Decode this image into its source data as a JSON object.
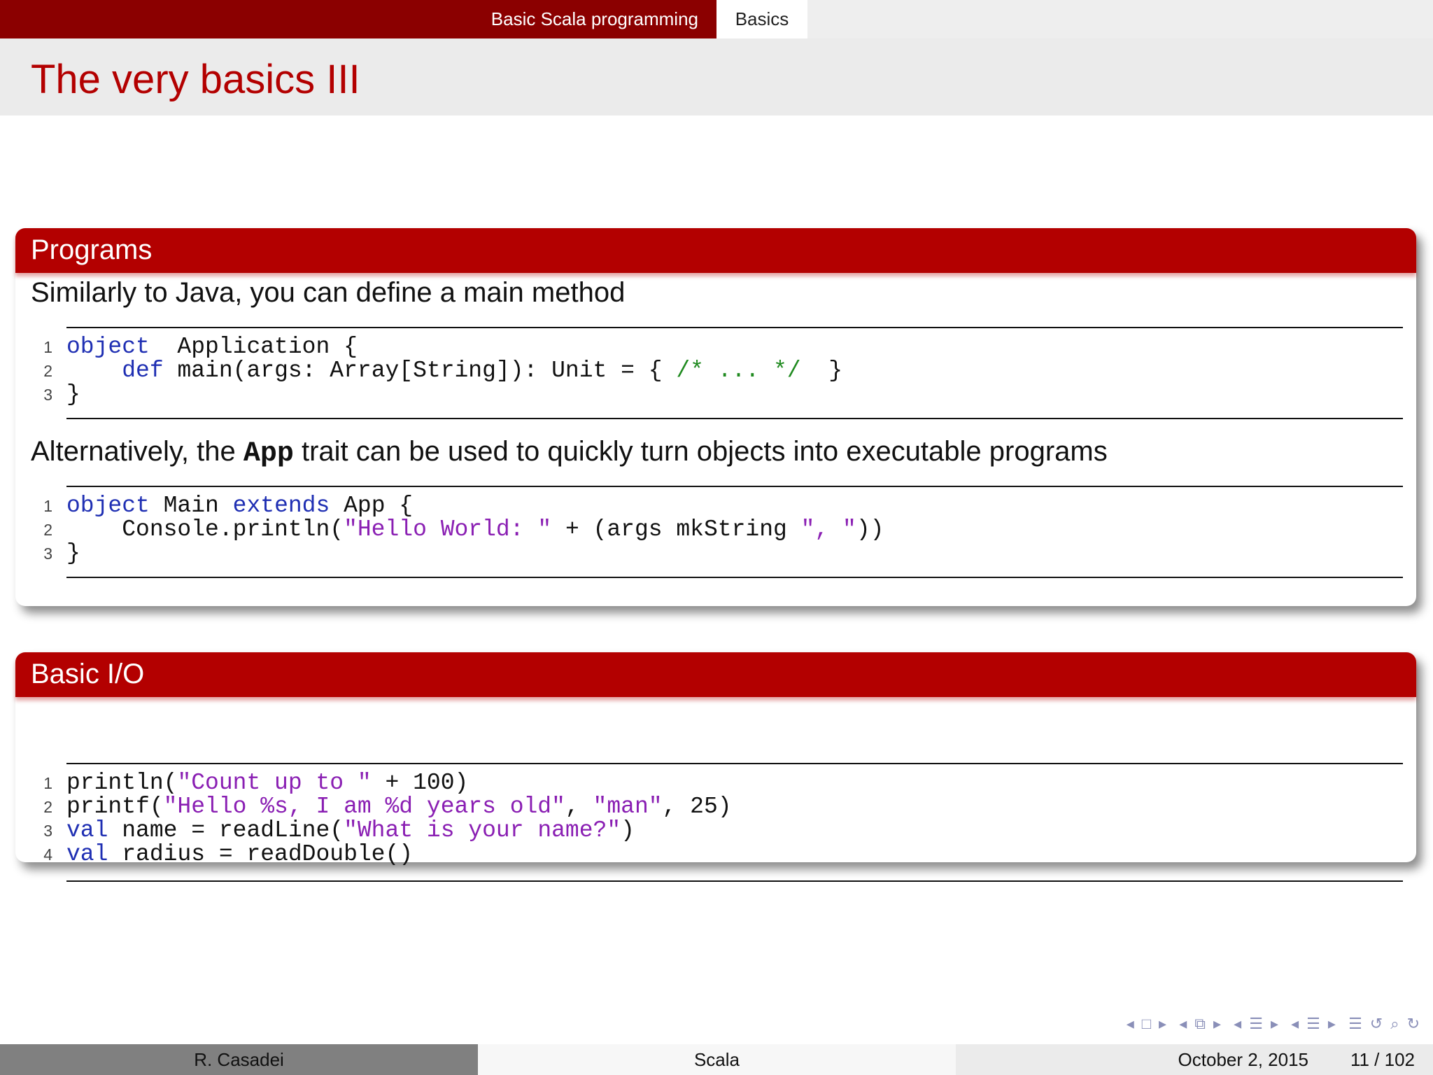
{
  "nav": {
    "section": "Basic Scala programming",
    "subsection": "Basics"
  },
  "frame": {
    "title": "The very basics III"
  },
  "blocks": {
    "programs": {
      "title": "Programs",
      "intro": "Similarly to Java, you can define a main method",
      "code1": [
        {
          "n": "1",
          "parts": [
            [
              "kw",
              "object"
            ],
            [
              "",
              "  Application {"
            ]
          ]
        },
        {
          "n": "2",
          "parts": [
            [
              "",
              "    "
            ],
            [
              "kw",
              "def"
            ],
            [
              "",
              " main(args: Array[String]): Unit = { "
            ],
            [
              "com",
              "/* ... */"
            ],
            [
              "",
              "  }"
            ]
          ]
        },
        {
          "n": "3",
          "parts": [
            [
              "",
              "}"
            ]
          ]
        }
      ],
      "alt_before": "Alternatively, the ",
      "alt_mono": "App",
      "alt_after": " trait can be used to quickly turn objects into executable programs",
      "code2": [
        {
          "n": "1",
          "parts": [
            [
              "kw",
              "object"
            ],
            [
              "",
              " Main "
            ],
            [
              "kw",
              "extends"
            ],
            [
              "",
              " App {"
            ]
          ]
        },
        {
          "n": "2",
          "parts": [
            [
              "",
              "    Console.println("
            ],
            [
              "str",
              "\"Hello World: \""
            ],
            [
              "",
              " + (args mkString "
            ],
            [
              "str",
              "\", \""
            ],
            [
              "",
              "))"
            ]
          ]
        },
        {
          "n": "3",
          "parts": [
            [
              "",
              "}"
            ]
          ]
        }
      ]
    },
    "io": {
      "title": "Basic I/O",
      "code": [
        {
          "n": "1",
          "parts": [
            [
              "",
              "println("
            ],
            [
              "str",
              "\"Count up to \""
            ],
            [
              "",
              " + 100)"
            ]
          ]
        },
        {
          "n": "2",
          "parts": [
            [
              "",
              "printf("
            ],
            [
              "str",
              "\"Hello %s, I am %d years old\""
            ],
            [
              "",
              ", "
            ],
            [
              "str",
              "\"man\""
            ],
            [
              "",
              ", 25)"
            ]
          ]
        },
        {
          "n": "3",
          "parts": [
            [
              "kw",
              "val"
            ],
            [
              "",
              " name = readLine("
            ],
            [
              "str",
              "\"What is your name?\""
            ],
            [
              "",
              ")"
            ]
          ]
        },
        {
          "n": "4",
          "parts": [
            [
              "kw",
              "val"
            ],
            [
              "",
              " radius = readDouble()"
            ]
          ]
        }
      ]
    }
  },
  "nav_symbols": {
    "color": "#8a8fb8",
    "icons": [
      "arrow-left-icon",
      "frame-icon",
      "arrow-right-icon",
      "arrow-left-icon",
      "subsection-icon",
      "arrow-right-icon",
      "arrow-left-icon",
      "section-icon",
      "arrow-right-icon",
      "arrow-left-icon",
      "doc-icon",
      "arrow-right-icon",
      "doc-end-icon",
      "undo-icon",
      "search-icon",
      "redo-icon"
    ]
  },
  "footer": {
    "author": "R. Casadei",
    "title": "Scala",
    "date": "October 2, 2015",
    "page": "11 / 102"
  },
  "colors": {
    "accent": "#b30000",
    "topbar": "#8b0000",
    "keyword": "#1f2fb3",
    "string": "#8a1fb3",
    "comment": "#1f8a1f"
  }
}
